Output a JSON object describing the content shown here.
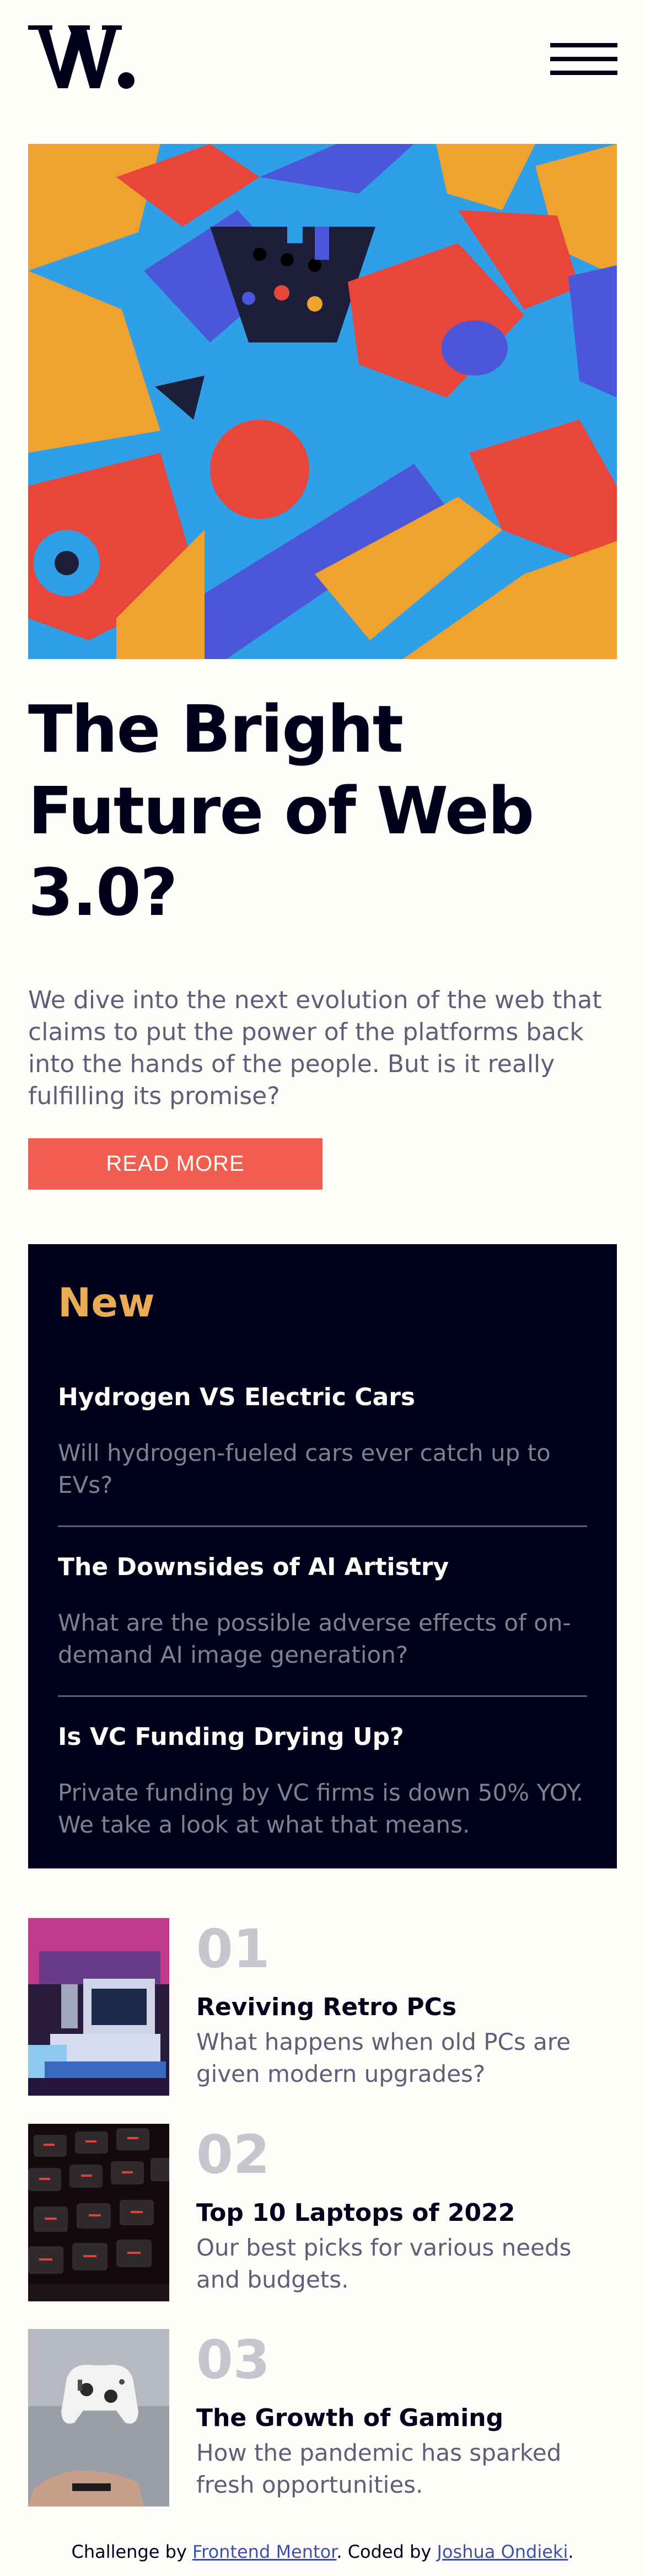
{
  "header": {
    "logo_text": "W.",
    "menu_icon": "hamburger-icon"
  },
  "hero": {
    "image_icon": "geometric-blocks-illustration",
    "title": "The Bright Future of Web 3.0?",
    "description": "We dive into the next evolution of the web that claims to put the power of the platforms back into the hands of the people. But is it really fulfilling its promise?",
    "button_label": "READ MORE"
  },
  "new_section": {
    "heading": "New",
    "items": [
      {
        "title": "Hydrogen VS Electric Cars",
        "text": "Will hydrogen-fueled cars ever catch up to EVs?"
      },
      {
        "title": "The Downsides of AI Artistry",
        "text": "What are the possible adverse effects of on-demand AI image generation?"
      },
      {
        "title": "Is VC Funding Drying Up?",
        "text": "Private funding by VC firms is down 50% YOY. We take a look at what that means."
      }
    ]
  },
  "articles": [
    {
      "number": "01",
      "title": "Reviving Retro PCs",
      "text": "What happens when old PCs are given modern upgrades?",
      "image_icon": "retro-pc-photo"
    },
    {
      "number": "02",
      "title": "Top 10 Laptops of 2022",
      "text": "Our best picks for various needs and budgets.",
      "image_icon": "laptop-keyboard-photo"
    },
    {
      "number": "03",
      "title": "The Growth of Gaming",
      "text": "How the pandemic has sparked fresh opportunities.",
      "image_icon": "game-controller-photo"
    }
  ],
  "footer": {
    "prefix": "Challenge by ",
    "challenge_link": "Frontend Mentor",
    "middle": ". Coded by ",
    "author_link": "Joshua Ondieki",
    "suffix": "."
  },
  "colors": {
    "background": "#fffdfa",
    "dark": "#00001a",
    "accent_red": "#f15e50",
    "accent_orange": "#e9ab53",
    "muted": "#5d5f79",
    "grey": "#c5c6ce"
  }
}
